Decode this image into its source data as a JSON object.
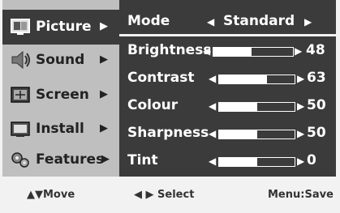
{
  "left_menu": {
    "items": [
      {
        "label": "Picture",
        "arrow": "▶",
        "icon": "picture-icon"
      },
      {
        "label": "Sound",
        "arrow": "▶",
        "icon": "sound-icon"
      },
      {
        "label": "Screen",
        "arrow": "▶",
        "icon": "screen-icon"
      },
      {
        "label": "Install",
        "arrow": "▶",
        "icon": "install-icon"
      },
      {
        "label": "Features",
        "arrow": "▶",
        "icon": "features-icon"
      }
    ]
  },
  "settings": {
    "mode": {
      "label": "Mode",
      "value": "Standard",
      "left": "◀",
      "right": "▶"
    },
    "brightness": {
      "label": "Brightness",
      "value": "48",
      "level": 0.48,
      "left": "◀",
      "right": "▶"
    },
    "contrast": {
      "label": "Contrast",
      "value": "63",
      "level": 0.63,
      "left": "◀",
      "right": "▶"
    },
    "colour": {
      "label": "Colour",
      "value": "50",
      "level": 0.5,
      "left": "◀",
      "right": "▶"
    },
    "sharpness": {
      "label": "Sharpness",
      "value": "50",
      "level": 0.5,
      "left": "◀",
      "right": "▶"
    },
    "tint": {
      "label": "Tint",
      "value": "0",
      "level": 0.5,
      "left": "◀",
      "right": "▶"
    }
  },
  "footer": {
    "move": "▲▼Move",
    "select": "◀ ▶ Select",
    "save": "Menu:Save"
  },
  "colors": {
    "panel_dark": "#3b3b3b",
    "menu_gray": "#bfbfbf",
    "background": "#f2f2f2"
  }
}
